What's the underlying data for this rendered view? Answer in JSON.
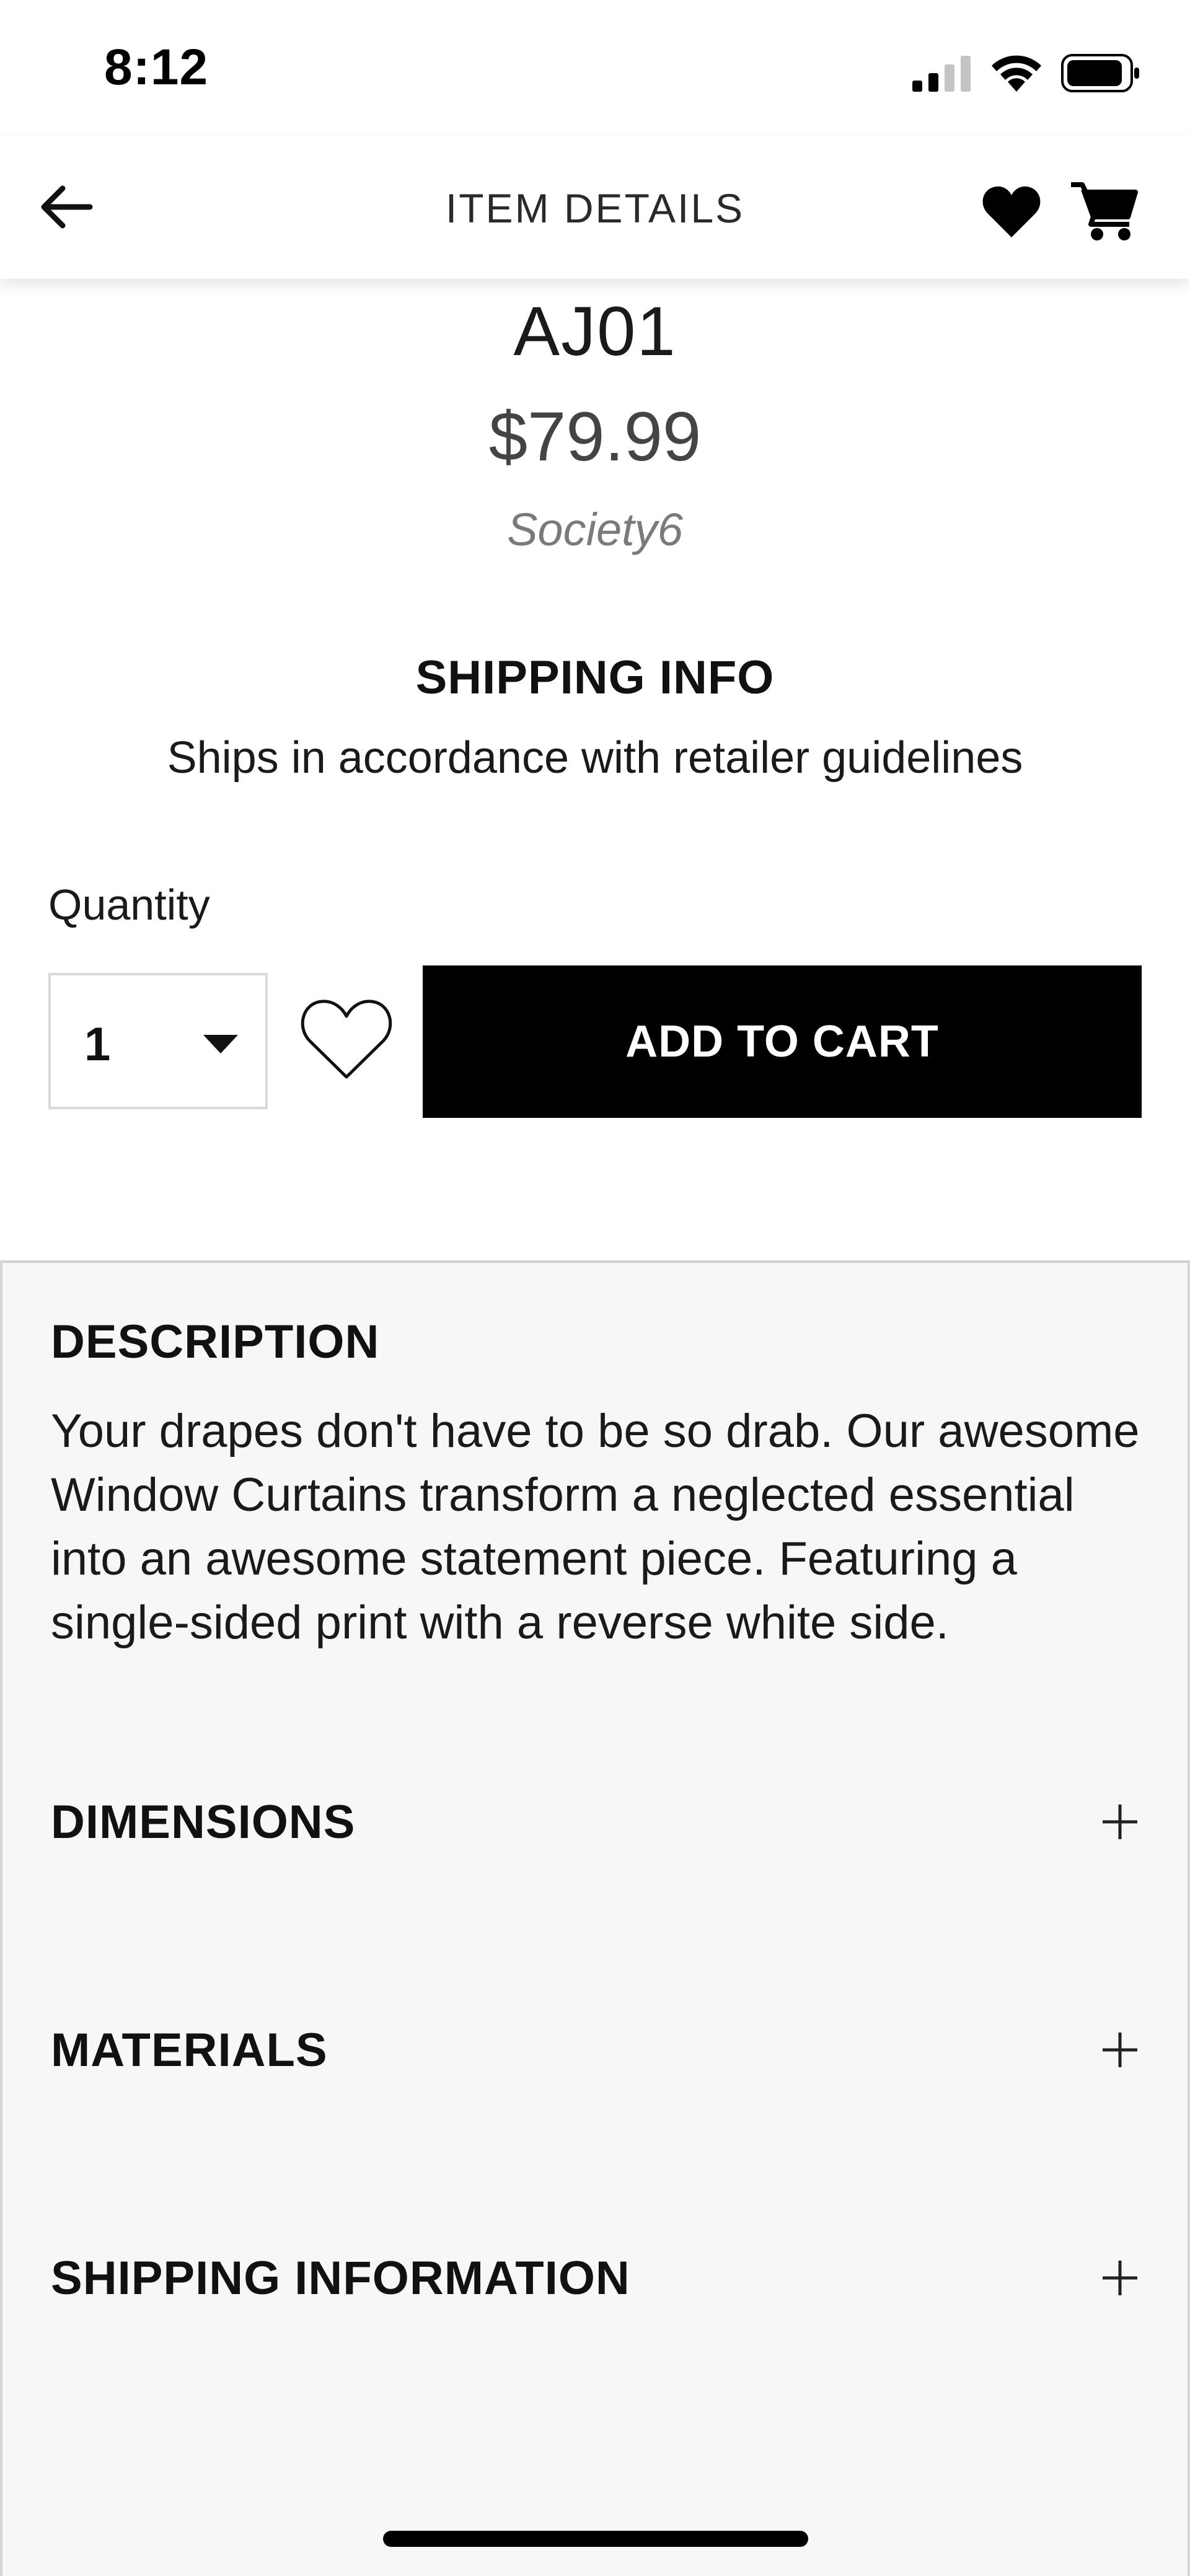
{
  "status_bar": {
    "time": "8:12",
    "icons": [
      "cellular-signal-icon",
      "wifi-icon",
      "battery-icon"
    ]
  },
  "header": {
    "title": "ITEM DETAILS",
    "icons": [
      "back-arrow-icon",
      "heart-icon",
      "cart-icon"
    ]
  },
  "product": {
    "name": "AJ01",
    "price": "$79.99",
    "brand": "Society6"
  },
  "shipping_info": {
    "heading": "SHIPPING INFO",
    "text": "Ships in accordance with retailer guidelines"
  },
  "purchase": {
    "quantity_label": "Quantity",
    "quantity_value": "1",
    "add_to_cart_label": "ADD TO CART"
  },
  "details": {
    "description_heading": "DESCRIPTION",
    "description_text": "Your drapes don't have to be so drab. Our awesome Window Curtains transform a neglected essential into an awesome statement piece. Featuring a single-sided print with a reverse white side.",
    "sections": [
      {
        "label": "DIMENSIONS"
      },
      {
        "label": "MATERIALS"
      },
      {
        "label": "SHIPPING INFORMATION"
      }
    ]
  },
  "colors": {
    "accent": "#000000",
    "panel_background": "#f7f7f7",
    "muted_text": "#7a7a7a"
  }
}
